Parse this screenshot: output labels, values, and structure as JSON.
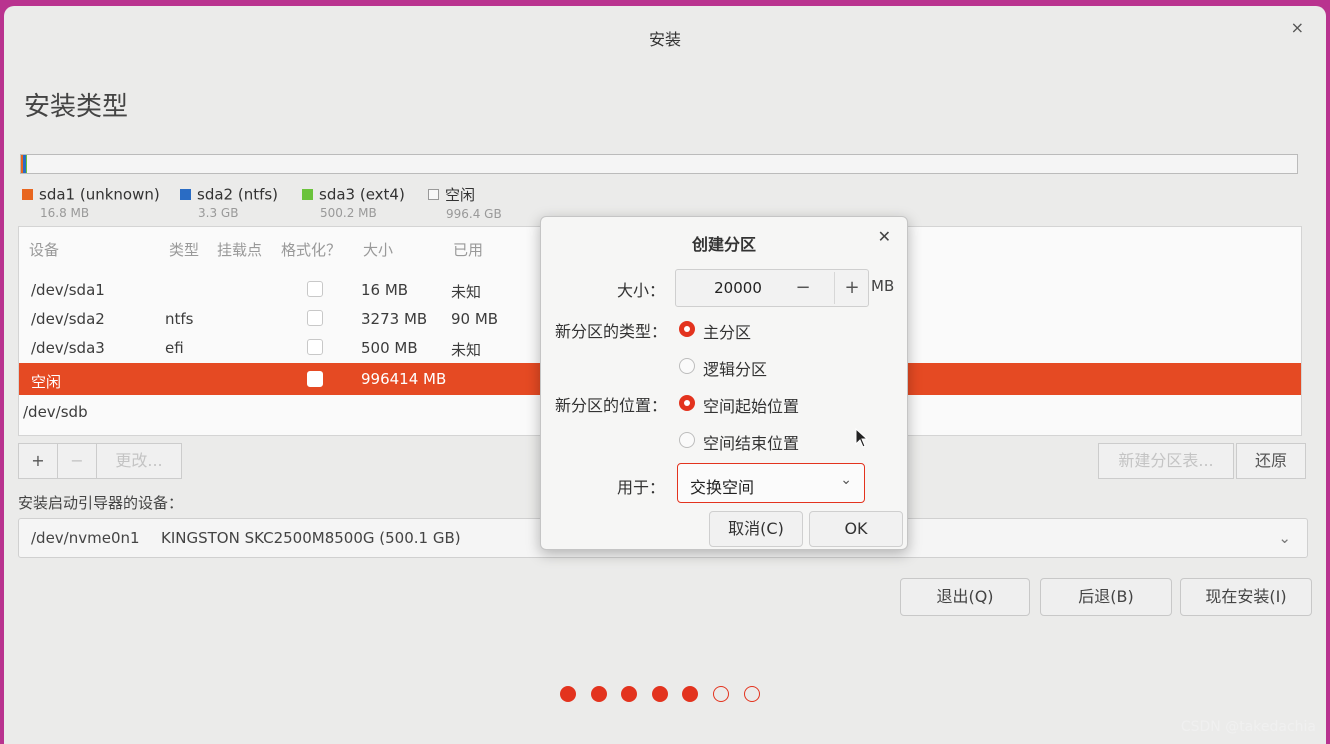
{
  "window": {
    "title": "安装",
    "close_icon": "×"
  },
  "page_title": "安装类型",
  "legend": [
    {
      "name": "sda1 (unknown)",
      "size": "16.8 MB",
      "color": "#e8661f"
    },
    {
      "name": "sda2 (ntfs)",
      "size": "3.3 GB",
      "color": "#2a6cc4"
    },
    {
      "name": "sda3 (ext4)",
      "size": "500.2 MB",
      "color": "#6bc33c"
    },
    {
      "name": "空闲",
      "size": "996.4 GB",
      "color": "#f8f8f8"
    }
  ],
  "table": {
    "headers": [
      "设备",
      "类型",
      "挂载点",
      "格式化？",
      "大小",
      "已用"
    ],
    "rows": [
      {
        "device": "/dev/sda1",
        "type": "",
        "size": "16 MB",
        "used": "未知"
      },
      {
        "device": "/dev/sda2",
        "type": "ntfs",
        "size": "3273 MB",
        "used": "90 MB"
      },
      {
        "device": "/dev/sda3",
        "type": "efi",
        "size": "500 MB",
        "used": "未知"
      },
      {
        "device": "空闲",
        "type": "",
        "size": "996414 MB",
        "used": ""
      },
      {
        "device": "/dev/sdb",
        "type": "",
        "size": "",
        "used": ""
      }
    ]
  },
  "table_buttons": {
    "add": "+",
    "remove": "−",
    "change": "更改...",
    "new_table": "新建分区表...",
    "revert": "还原"
  },
  "boot": {
    "label": "安装启动引导器的设备：",
    "device": "/dev/nvme0n1",
    "model": "KINGSTON SKC2500M8500G (500.1 GB)"
  },
  "bottom_buttons": {
    "quit": "退出(Q)",
    "back": "后退(B)",
    "install": "现在安装(I)"
  },
  "progress": {
    "total_steps": 7,
    "completed_steps": 5
  },
  "watermark": "CSDN @takedachia",
  "dialog": {
    "title": "创建分区",
    "size_label": "大小：",
    "size_value": "20000",
    "minus": "−",
    "plus": "+",
    "unit": "MB",
    "type_label": "新分区的类型：",
    "type_primary": "主分区",
    "type_logical": "逻辑分区",
    "location_label": "新分区的位置：",
    "location_start": "空间起始位置",
    "location_end": "空间结束位置",
    "use_label": "用于：",
    "use_value": "交换空间",
    "cancel": "取消(C)",
    "ok": "OK"
  },
  "colors": {
    "accent": "#e3331e",
    "selected_row": "#e54a23"
  }
}
